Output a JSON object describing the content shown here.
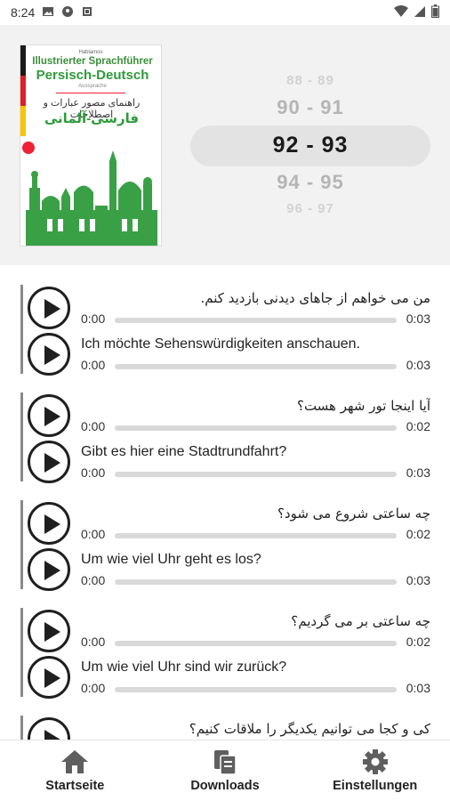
{
  "status_bar": {
    "time": "8:24",
    "icons": [
      "image-icon",
      "vpn-key-icon",
      "android-icon",
      "wifi-icon",
      "signal-icon",
      "battery-icon"
    ]
  },
  "book_cover": {
    "publisher": "Hablamos",
    "title_line1": "Illustrierter Sprachführer",
    "title_line2": "Persisch-Deutsch",
    "subtitle": "Aussprache",
    "fa_line1": "راهنمای مصور عبارات و اصطلاحات",
    "fa_line2": "فارسی-آلمانی"
  },
  "picker": {
    "items": [
      "88 - 89",
      "90 - 91",
      "92 - 93",
      "94 - 95",
      "96 - 97"
    ],
    "selected": "92 - 93"
  },
  "phrases": [
    {
      "fa": "من می خواهم از جاهای دیدنی بازدید کنم.",
      "fa_start": "0:00",
      "fa_end": "0:03",
      "de": "Ich möchte Sehenswürdigkeiten anschauen.",
      "de_start": "0:00",
      "de_end": "0:03"
    },
    {
      "fa": "آیا اینجا تور شهر هست؟",
      "fa_start": "0:00",
      "fa_end": "0:02",
      "de": "Gibt es hier eine Stadtrundfahrt?",
      "de_start": "0:00",
      "de_end": "0:03"
    },
    {
      "fa": "چه ساعتی شروع می شود؟",
      "fa_start": "0:00",
      "fa_end": "0:02",
      "de": "Um wie viel Uhr geht es los?",
      "de_start": "0:00",
      "de_end": "0:03"
    },
    {
      "fa": "چه ساعتی بر می گردیم؟",
      "fa_start": "0:00",
      "fa_end": "0:02",
      "de": "Um wie viel Uhr sind wir zurück?",
      "de_start": "0:00",
      "de_end": "0:03"
    },
    {
      "fa": "کی و کجا می توانیم یکدیگر را ملاقات کنیم؟"
    }
  ],
  "bottom_nav": {
    "home_label": "Startseite",
    "downloads_label": "Downloads",
    "settings_label": "Einstellungen"
  },
  "colors": {
    "accent_green": "#2f9b3b",
    "play_dark": "#1f1f1f",
    "header_bg": "#f2f2f2"
  }
}
